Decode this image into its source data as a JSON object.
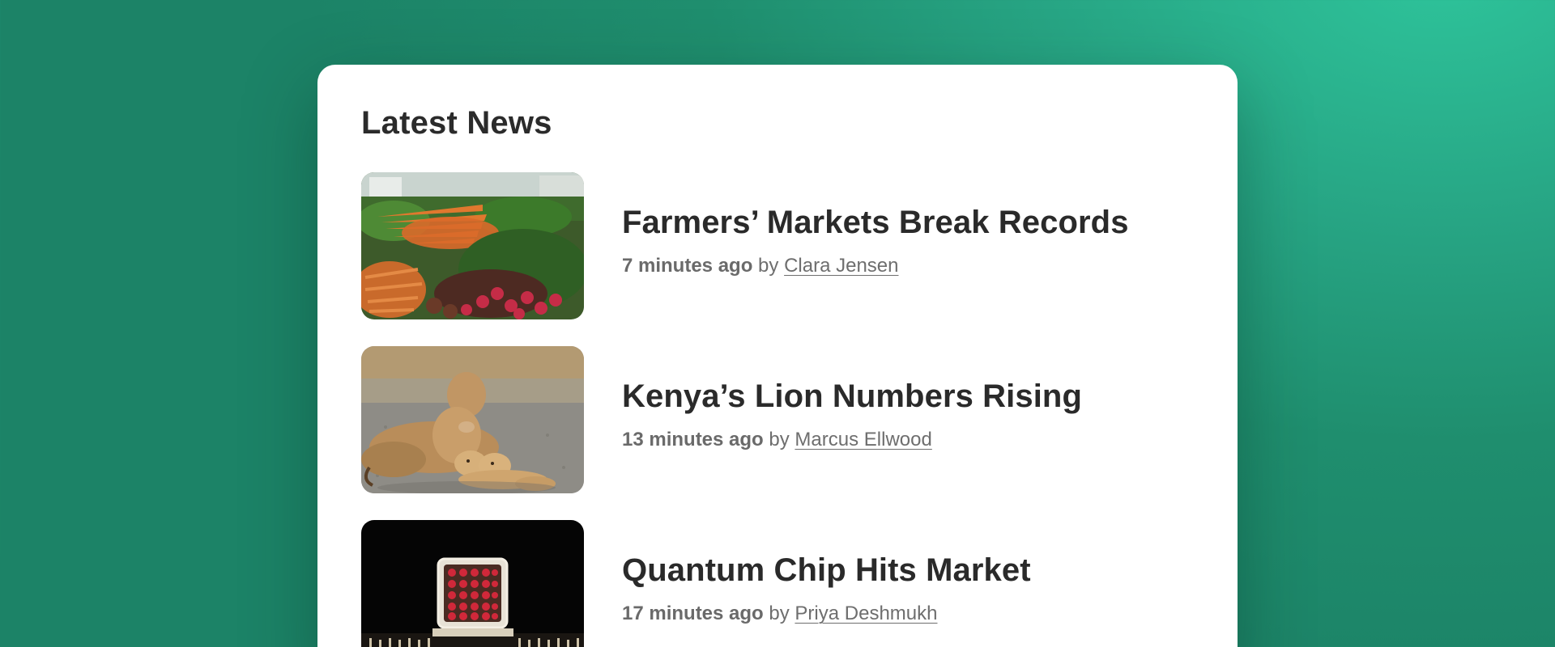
{
  "card": {
    "title": "Latest News"
  },
  "articles": [
    {
      "headline": "Farmers’ Markets Break Records",
      "time": "7 minutes ago",
      "by": "by",
      "author": "Clara Jensen",
      "image": "vegetables-photo"
    },
    {
      "headline": "Kenya’s Lion Numbers Rising",
      "time": "13 minutes ago",
      "by": "by",
      "author": "Marcus Ellwood",
      "image": "lioness-with-cubs-photo"
    },
    {
      "headline": "Quantum Chip Hits Market",
      "time": "17 minutes ago",
      "by": "by",
      "author": "Priya Deshmukh",
      "image": "quantum-chip-photo"
    }
  ],
  "colors": {
    "background_light": "#2ec49b",
    "background_dark": "#1c8367",
    "card": "#ffffff",
    "headline": "#2a2a2a",
    "meta": "#6e6e6e"
  }
}
